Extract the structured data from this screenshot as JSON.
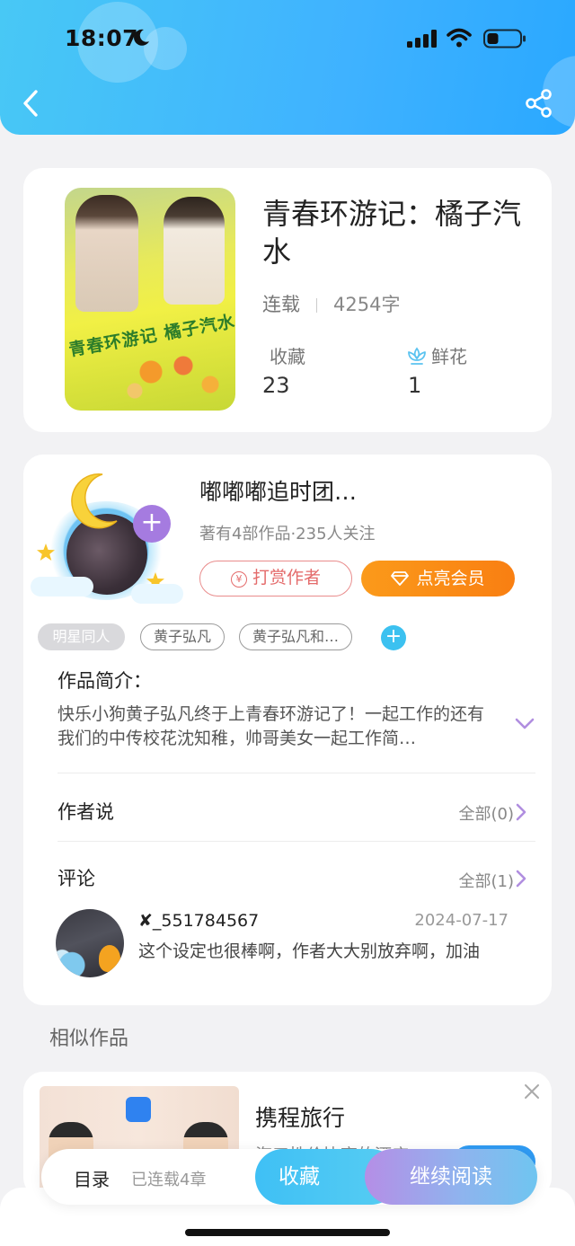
{
  "status_bar": {
    "time": "18:07"
  },
  "book": {
    "cover_title": "青春环游记 橘子汽水",
    "title": "青春环游记：橘子汽水",
    "status": "连载",
    "word_count": "4254字",
    "favorites_label": "收藏",
    "favorites_count": "23",
    "flowers_label": "鲜花",
    "flowers_count": "1"
  },
  "author": {
    "name": "嘟嘟嘟追时团…",
    "meta": "著有4部作品·235人关注",
    "reward_label": "打赏作者",
    "vip_label": "点亮会员"
  },
  "tags": [
    "明星同人",
    "黄子弘凡",
    "黄子弘凡和…"
  ],
  "intro": {
    "heading": "作品简介：",
    "text": "快乐小狗黄子弘凡终于上青春环游记了！一起工作的还有我们的中传校花沈知稚，帅哥美女一起工作简…"
  },
  "author_says": {
    "heading": "作者说",
    "all_label": "全部(0)"
  },
  "comments": {
    "heading": "评论",
    "all_label": "全部(1)",
    "items": [
      {
        "user": "✘_551784567",
        "date": "2024-07-17",
        "text": "这个设定也很棒啊，作者大大别放弃啊，加油"
      }
    ]
  },
  "similar": {
    "heading": "相似作品",
    "ad_name": "携程旅行",
    "ad_desc": "海口性价比高的酒店"
  },
  "bottom_bar": {
    "toc_label": "目录",
    "chapter_count": "已连载4章",
    "collect_label": "收藏",
    "read_label": "继续阅读"
  },
  "colors": {
    "header": "#3fb2ff",
    "vip": "#f97f12",
    "reward": "#e46b6b",
    "accent_purple": "#a57be0"
  }
}
